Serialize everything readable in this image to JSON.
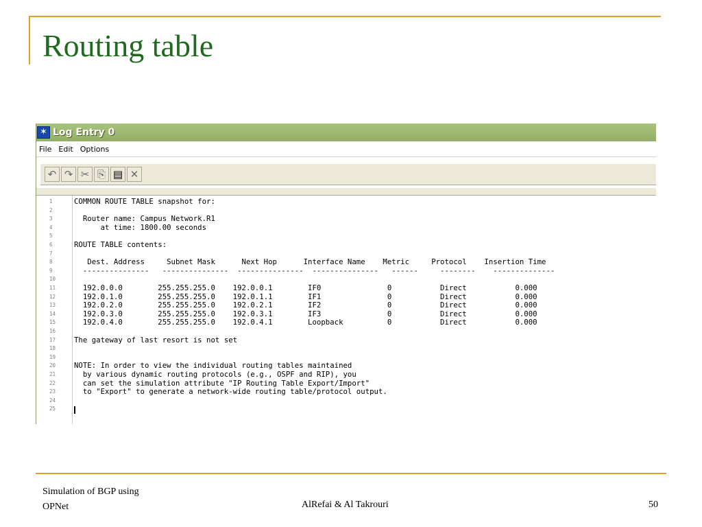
{
  "slide": {
    "title": "Routing table",
    "footer_left_line1": "Simulation of  BGP using",
    "footer_left_line2": "OPNet",
    "footer_center": "AlRefai & Al Takrouri",
    "page_number": "50",
    "accent_color": "#e0a020",
    "title_color": "#1f6a1f"
  },
  "window": {
    "title": "Log Entry 0",
    "menu": [
      "File",
      "Edit",
      "Options"
    ],
    "toolbar": [
      {
        "icon": "undo-icon",
        "glyph": "↶"
      },
      {
        "icon": "redo-icon",
        "glyph": "↷"
      },
      {
        "icon": "cut-icon",
        "glyph": "✂"
      },
      {
        "icon": "copy-icon",
        "glyph": "⎘"
      },
      {
        "icon": "paste-icon",
        "glyph": "📋"
      },
      {
        "icon": "delete-icon",
        "glyph": "✕"
      }
    ],
    "lines": [
      "COMMON ROUTE TABLE snapshot for:",
      "",
      "  Router name: Campus Network.R1",
      "      at time: 1800.00 seconds",
      "",
      "ROUTE TABLE contents:",
      "",
      "   Dest. Address     Subnet Mask      Next Hop      Interface Name    Metric     Protocol    Insertion Time",
      "  ---------------   ---------------  ---------------  ---------------   ------     --------    --------------",
      "",
      "  192.0.0.0        255.255.255.0    192.0.0.1        IF0               0           Direct           0.000",
      "  192.0.1.0        255.255.255.0    192.0.1.1        IF1               0           Direct           0.000",
      "  192.0.2.0        255.255.255.0    192.0.2.1        IF2               0           Direct           0.000",
      "  192.0.3.0        255.255.255.0    192.0.3.1        IF3               0           Direct           0.000",
      "  192.0.4.0        255.255.255.0    192.0.4.1        Loopback          0           Direct           0.000",
      "",
      "The gateway of last resort is not set",
      "",
      "",
      "NOTE: In order to view the individual routing tables maintained",
      "  by various dynamic routing protocols (e.g., OSPF and RIP), you",
      "  can set the simulation attribute \"IP Routing Table Export/Import\"",
      "  to \"Export\" to generate a network-wide routing table/protocol output.",
      "",
      ""
    ]
  }
}
